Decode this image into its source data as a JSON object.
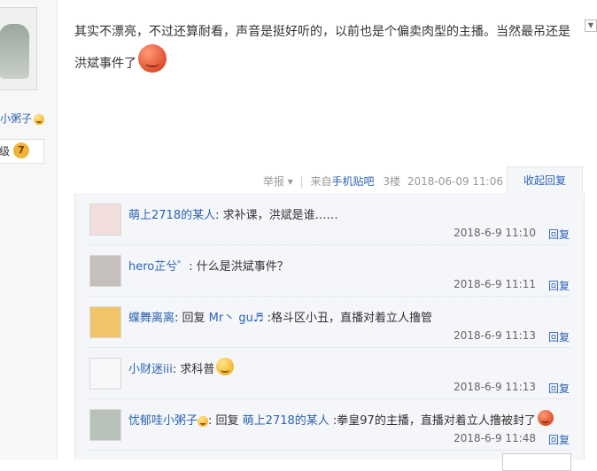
{
  "left_panel": {
    "username": "小粥子",
    "level_text": "级",
    "level": "7"
  },
  "post": {
    "text_line1": "其实不漂亮，不过还算耐看，声音是挺好听的，以前也是个偏卖肉型的主播。当然最吊还是",
    "text_line2": "洪斌事件了",
    "collapse_arrow": "▼"
  },
  "meta": {
    "report": "举报",
    "report_arrow": "▾",
    "separator": "|",
    "source_prefix": "来自",
    "source_link": "手机贴吧",
    "floor": "3楼",
    "datetime": "2018-06-09 11:06",
    "collapse_reply": "收起回复"
  },
  "replies": [
    {
      "name": "萌上2718的某人",
      "colon": ": ",
      "text": "求补课，洪斌是谁……",
      "time": "2018-6-9 11:10",
      "reply_label": "回复",
      "avatar_color": "#f3dede"
    },
    {
      "name": "hero芷兮゜",
      "colon": ": ",
      "text": "什么是洪斌事件？",
      "time": "2018-6-9 11:11",
      "reply_label": "回复",
      "avatar_color": "#c5c0bd"
    },
    {
      "name": "蝶舞离离",
      "colon": ": ",
      "prefix": "回复 ",
      "target": "Mr丶 gu♬",
      "text": " :格斗区小丑，直播对着立人撸管",
      "time": "2018-6-9 11:13",
      "reply_label": "回复",
      "avatar_color": "#f0c56a"
    },
    {
      "name": "小财迷iii",
      "colon": ": ",
      "text": "求科普",
      "time": "2018-6-9 11:13",
      "reply_label": "回复",
      "avatar_color": "#f7f7f7"
    },
    {
      "name": "忧郁哇小粥子",
      "colon": ": ",
      "prefix": "回复 ",
      "target": "萌上2718的某人",
      "text": " :拳皇97的主播，直播对着立人撸被封了",
      "time": "2018-6-9 11:48",
      "reply_label": "回复",
      "avatar_color": "#b8c2bb"
    }
  ],
  "colors": {
    "link": "#2d64b3",
    "reply_bg": "#f4f6f9",
    "text": "#333333",
    "muted": "#999999"
  }
}
